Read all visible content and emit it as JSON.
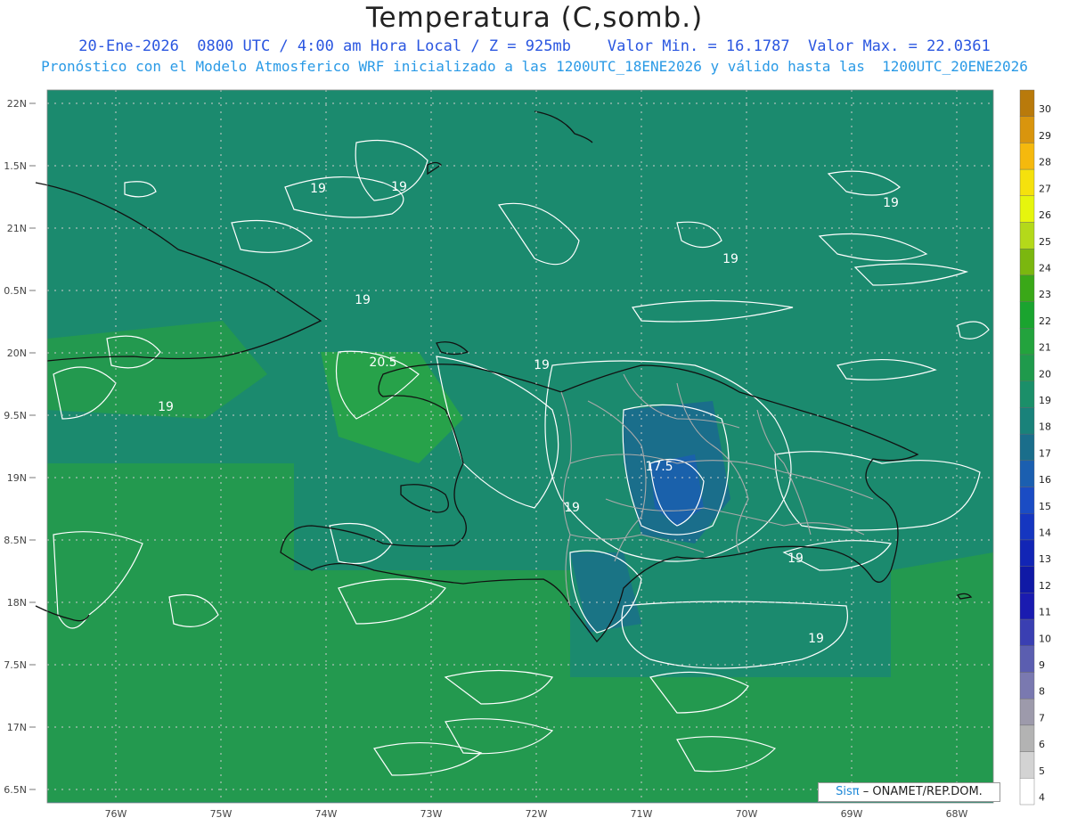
{
  "title": "Temperatura (C,somb.)",
  "subtitle_line1": "20-Ene-2026  0800 UTC / 4:00 am Hora Local / Z = 925mb    Valor Min. = 16.1787  Valor Max. = 22.0361",
  "subtitle_line2": "Pronóstico con el Modelo Atmosferico WRF inicializado a las 1200UTC_18ENE2026 y válido hasta las  1200UTC_20ENE2026",
  "lat_labels": [
    "22N",
    "1.5N",
    "21N",
    "0.5N",
    "20N",
    "9.5N",
    "19N",
    "8.5N",
    "18N",
    "7.5N",
    "17N",
    "6.5N"
  ],
  "lon_labels": [
    "76W",
    "75W",
    "74W",
    "73W",
    "72W",
    "71W",
    "70W",
    "69W",
    "68W"
  ],
  "colorbar_labels": [
    "30",
    "29",
    "28",
    "27",
    "26",
    "25",
    "24",
    "23",
    "22",
    "21",
    "20",
    "19",
    "18",
    "17",
    "16",
    "15",
    "14",
    "13",
    "12",
    "11",
    "10",
    "9",
    "8",
    "7",
    "6",
    "5",
    "4"
  ],
  "colorbar_colors": [
    "#b97a0b",
    "#d9950d",
    "#f5b90d",
    "#f5e10d",
    "#e6f50d",
    "#b4d91a",
    "#7bb70f",
    "#3aa818",
    "#1aa42f",
    "#23a33d",
    "#1f9a4c",
    "#1b8f69",
    "#19827a",
    "#1a6e8b",
    "#1b5fb0",
    "#1a4cc4",
    "#1536c0",
    "#1225b5",
    "#1019a6",
    "#1a1bb0",
    "#3a3fb2",
    "#5b5eb0",
    "#7a79b0",
    "#9d9aab",
    "#b3b3b3",
    "#d3d3d3",
    "#ffffff"
  ],
  "contour_labels": [
    {
      "text": "19",
      "key": "a"
    },
    {
      "text": "19",
      "key": "b"
    },
    {
      "text": "19",
      "key": "c"
    },
    {
      "text": "19",
      "key": "d"
    },
    {
      "text": "19",
      "key": "e"
    },
    {
      "text": "20.5",
      "key": "f"
    },
    {
      "text": "19",
      "key": "g"
    },
    {
      "text": "19",
      "key": "h"
    },
    {
      "text": "17.5",
      "key": "i"
    },
    {
      "text": "19",
      "key": "j"
    },
    {
      "text": "19",
      "key": "k"
    },
    {
      "text": "19",
      "key": "l"
    }
  ],
  "credit_brand": "Sisπ",
  "credit_text": "– ONAMET/REP.DOM."
}
